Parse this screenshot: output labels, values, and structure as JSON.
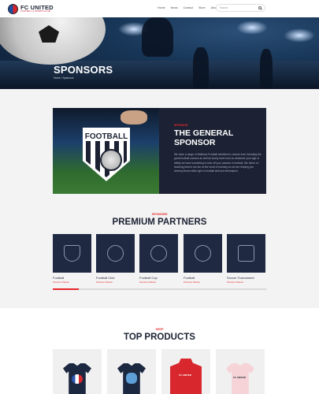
{
  "header": {
    "logo_title": "FC UNITED",
    "logo_subtitle": "FOOTBALL & SPORTS CLUB",
    "nav": [
      "Home",
      "News",
      "Contact",
      "Store",
      "About Us"
    ],
    "search_placeholder": "Search"
  },
  "hero": {
    "title": "SPONSORS",
    "breadcrumb": "Home / Sponsors"
  },
  "general_sponsor": {
    "image_word": "FOOTBALL",
    "kicker": "SPONSOR",
    "title_line1": "THE GENERAL",
    "title_line2": "SPONSOR",
    "text": "We have a range of Mattress Football activities to choose from including the great football courses as well as lovely short runs so whatever your age or ability we have something to kick off your passion in football. We thrive on teaching team's are fun at the heart of learning so we are helping you develop those skills right in football skill and techniques."
  },
  "partners": {
    "kicker": "SPONSORS",
    "title": "PREMIUM PARTNERS",
    "items": [
      {
        "name": "Football",
        "role": "Premium Partner",
        "icon": "football-crest-icon"
      },
      {
        "name": "Football Club",
        "role": "Premium Partner",
        "icon": "soccer-ball-icon"
      },
      {
        "name": "Football Cup",
        "role": "Premium Partner",
        "icon": "cup-badge-icon"
      },
      {
        "name": "Football",
        "role": "Premium Partner",
        "icon": "football-swoosh-icon"
      },
      {
        "name": "Soccer Tournament",
        "role": "Premium Partner",
        "icon": "tournament-shield-icon"
      }
    ],
    "progress": 0.12
  },
  "products": {
    "kicker": "SHOP",
    "title": "TOP PRODUCTS",
    "items": [
      {
        "label": "navy-tshirt-flag"
      },
      {
        "label": "navy-tshirt-player"
      },
      {
        "label": "red-hoodie",
        "print": "FC UNITED"
      },
      {
        "label": "pink-tshirt",
        "print": "FC UNITED"
      }
    ]
  },
  "colors": {
    "accent": "#e8252b",
    "navy": "#1c2233",
    "grey_bg": "#f3f3f3"
  }
}
